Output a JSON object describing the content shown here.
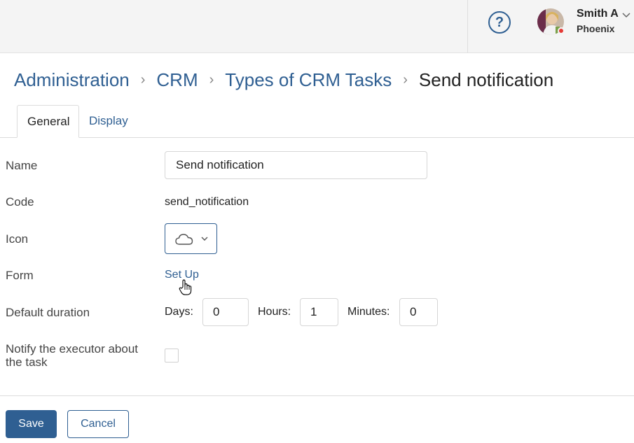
{
  "header": {
    "help_icon": "question-circle-icon",
    "help_glyph": "?",
    "user": {
      "name": "Smith A",
      "company": "Phoenix",
      "status_color": "#e53935"
    }
  },
  "breadcrumb": {
    "items": [
      "Administration",
      "CRM",
      "Types of CRM Tasks"
    ],
    "current": "Send notification",
    "separator": "›"
  },
  "tabs": [
    {
      "label": "General",
      "active": true
    },
    {
      "label": "Display",
      "active": false
    }
  ],
  "form": {
    "name": {
      "label": "Name",
      "value": "Send notification"
    },
    "code": {
      "label": "Code",
      "value": "send_notification"
    },
    "icon": {
      "label": "Icon",
      "selected_icon": "cloud-icon"
    },
    "form": {
      "label": "Form",
      "link": "Set Up"
    },
    "duration": {
      "label": "Default duration",
      "days_label": "Days:",
      "days": "0",
      "hours_label": "Hours:",
      "hours": "1",
      "minutes_label": "Minutes:",
      "minutes": "0"
    },
    "notify": {
      "label_line1": "Notify the executor about",
      "label_line2": "the task",
      "checked": false
    }
  },
  "actions": {
    "save": "Save",
    "cancel": "Cancel"
  },
  "colors": {
    "accent": "#2f5f92",
    "topbar": "#f4f4f4",
    "text": "#333333"
  }
}
